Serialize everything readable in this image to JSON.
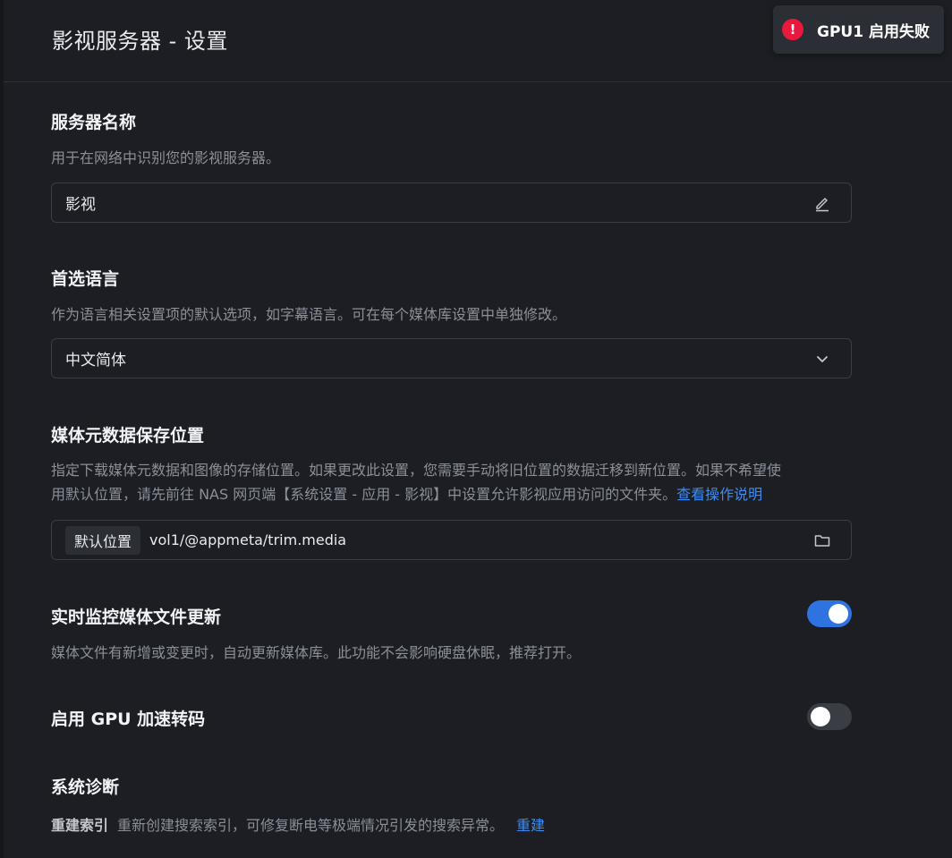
{
  "header": {
    "title": "影视服务器 - 设置"
  },
  "toast": {
    "icon": "error-icon",
    "icon_glyph": "!",
    "message": "GPU1 启用失败",
    "color": "#e8193c"
  },
  "server_name": {
    "title": "服务器名称",
    "description": "用于在网络中识别您的影视服务器。",
    "value": "影视",
    "icon": "edit-icon"
  },
  "language": {
    "title": "首选语言",
    "description": "作为语言相关设置项的默认选项，如字幕语言。可在每个媒体库设置中单独修改。",
    "selected": "中文简体",
    "icon": "chevron-down-icon"
  },
  "metadata": {
    "title": "媒体元数据保存位置",
    "description_line1": "指定下载媒体元数据和图像的存储位置。如果更改此设置，您需要手动将旧位置的数据迁移到新位置。如果不希望使",
    "description_line2": "用默认位置，请先前往 NAS 网页端【系统设置 - 应用 - 影视】中设置允许影视应用访问的文件夹。",
    "help_link": "查看操作说明",
    "tag": "默认位置",
    "path": "vol1/@appmeta/trim.media",
    "icon": "folder-icon"
  },
  "realtime_monitor": {
    "title": "实时监控媒体文件更新",
    "description": "媒体文件有新增或变更时，自动更新媒体库。此功能不会影响硬盘休眠，推荐打开。",
    "enabled": true
  },
  "gpu": {
    "title": "启用 GPU 加速转码",
    "enabled": false
  },
  "diagnostics": {
    "title": "系统诊断",
    "rebuild_label": "重建索引",
    "rebuild_desc": "重新创建搜索索引，可修复断电等极端情况引发的搜索异常。",
    "rebuild_action": "重建"
  },
  "colors": {
    "background": "#1c1e23",
    "accent": "#2f73e0",
    "link": "#3d8cf0",
    "error": "#e8193c"
  }
}
